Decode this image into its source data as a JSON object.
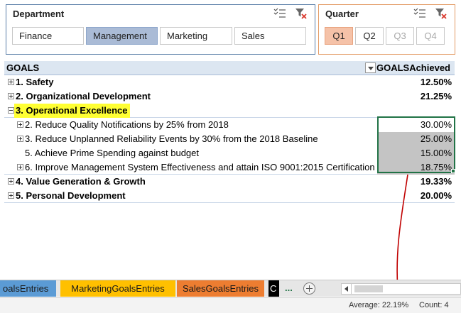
{
  "slicers": {
    "department": {
      "title": "Department",
      "items": [
        "Finance",
        "Management",
        "Marketing",
        "Sales"
      ],
      "selected": "Management",
      "accent": "#5b7fa8"
    },
    "quarter": {
      "title": "Quarter",
      "items": [
        "Q1",
        "Q2",
        "Q3",
        "Q4"
      ],
      "selected": "Q1",
      "disabled": [
        "Q3",
        "Q4"
      ],
      "accent": "#e39a63"
    }
  },
  "pivot": {
    "headers": {
      "label": "GOALS",
      "value": "GOALSAchieved"
    },
    "rows": [
      {
        "label": "1. Safety",
        "value": "12.50%",
        "level": 1,
        "expand": "plus"
      },
      {
        "label": "2. Organizational Development",
        "value": "21.25%",
        "level": 1,
        "expand": "plus"
      },
      {
        "label": "3. Operational Excellence",
        "value": "",
        "level": 1,
        "expand": "minus",
        "highlight": "#ffff33"
      },
      {
        "label": "2. Reduce Quality Notifications by 25% from 2018",
        "value": "30.00%",
        "level": 2,
        "expand": "plus"
      },
      {
        "label": "3. Reduce Unplanned Reliability Events by 30% from the 2018 Baseline",
        "value": "25.00%",
        "level": 2,
        "expand": "plus"
      },
      {
        "label": "5. Achieve Prime Spending against budget",
        "value": "15.00%",
        "level": 2,
        "expand": "none"
      },
      {
        "label": "6. Improve Management System Effectiveness and attain ISO 9001:2015 Certification",
        "value": "18.75%",
        "level": 2,
        "expand": "plus"
      },
      {
        "label": "4. Value Generation & Growth",
        "value": "19.33%",
        "level": 1,
        "expand": "plus"
      },
      {
        "label": "5. Personal Development",
        "value": "20.00%",
        "level": 1,
        "expand": "plus"
      }
    ]
  },
  "sheet_tabs": [
    {
      "label": "oalsEntries",
      "color": "#5b9bd5"
    },
    {
      "label": "MarketingGoalsEntries",
      "color": "#ffc000"
    },
    {
      "label": "SalesGoalsEntries",
      "color": "#ed7d31"
    },
    {
      "label": "C",
      "color": "#000000"
    }
  ],
  "tab_more": "...",
  "status_bar": {
    "average": "Average: 22.19%",
    "count": "Count: 4"
  },
  "annotation": {
    "color": "#c00000"
  },
  "icons": {
    "multi_select": "multi-select-icon",
    "clear_filter": "clear-filter-icon",
    "expand": "expand-icon",
    "collapse": "collapse-icon",
    "add_sheet": "add-sheet-icon",
    "dropdown": "filter-dropdown-icon"
  }
}
